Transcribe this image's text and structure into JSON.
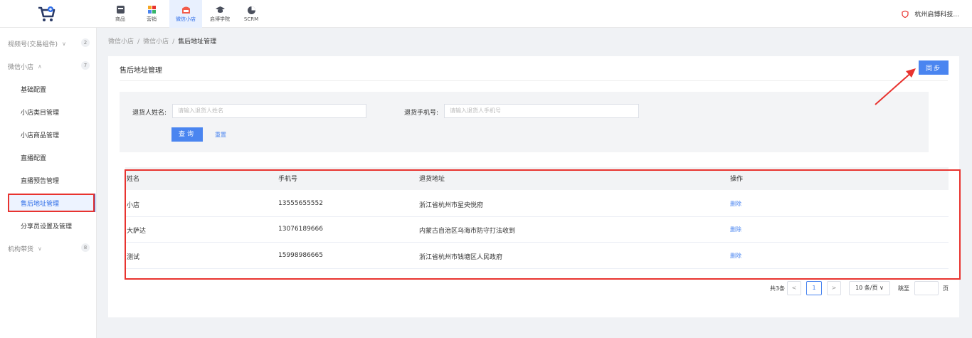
{
  "header": {
    "nav": [
      {
        "label": "商品",
        "icon": "product-icon"
      },
      {
        "label": "营销",
        "icon": "marketing-icon"
      },
      {
        "label": "微信小店",
        "icon": "shop-icon",
        "active": true
      },
      {
        "label": "启博学院",
        "icon": "academy-icon"
      },
      {
        "label": "SCRM",
        "icon": "scrm-icon"
      }
    ],
    "company": "杭州启博科技..."
  },
  "sidebar": {
    "groups": [
      {
        "label": "视频号(交易组件)",
        "count": "2"
      },
      {
        "label": "微信小店",
        "count": "7"
      },
      {
        "label": "机构带货",
        "count": "8"
      }
    ],
    "items": [
      {
        "label": "基础配置"
      },
      {
        "label": "小店类目管理"
      },
      {
        "label": "小店商品管理"
      },
      {
        "label": "直播配置"
      },
      {
        "label": "直播预告管理"
      },
      {
        "label": "售后地址管理",
        "active": true
      },
      {
        "label": "分享员设置及管理"
      }
    ]
  },
  "breadcrumb": [
    "微信小店",
    "微信小店",
    "售后地址管理"
  ],
  "page": {
    "title": "售后地址管理",
    "sync_label": "同步"
  },
  "search": {
    "name_label": "退货人姓名:",
    "name_placeholder": "请输入退货人姓名",
    "phone_label": "退货手机号:",
    "phone_placeholder": "请输入退货人手机号",
    "query_label": "查询",
    "reset_label": "重置"
  },
  "table": {
    "columns": [
      "姓名",
      "手机号",
      "退货地址",
      "操作"
    ],
    "rows": [
      {
        "name": "小店",
        "phone": "13555655552",
        "address": "浙江省杭州市星央悦府",
        "action": "删除"
      },
      {
        "name": "大萨达",
        "phone": "13076189666",
        "address": "内蒙古自治区乌海市防守打法收到",
        "action": "删除"
      },
      {
        "name": "测试",
        "phone": "15998986665",
        "address": "浙江省杭州市钱塘区人民政府",
        "action": "删除"
      }
    ]
  },
  "pagination": {
    "total": "共3条",
    "prev": "<",
    "current": "1",
    "next": ">",
    "page_size": "10 条/页",
    "jump_label": "跳至",
    "page_unit": "页"
  },
  "colors": {
    "accent": "#4a85f0",
    "highlight": "#e8332f"
  }
}
